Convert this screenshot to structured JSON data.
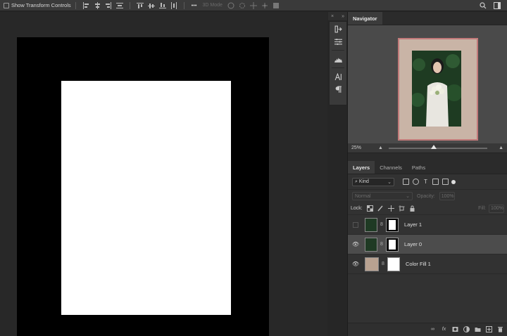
{
  "options_bar": {
    "show_transform_label": "Show Transform Controls",
    "mode_3d_label": "3D Mode",
    "more_label": "•••"
  },
  "navigator": {
    "tab_label": "Navigator",
    "zoom_value": "25%"
  },
  "layers_panel": {
    "tabs": [
      "Layers",
      "Channels",
      "Paths"
    ],
    "kind_label": "Kind",
    "blend_mode": "Normal",
    "opacity_label": "Opacity:",
    "opacity_value": "100%",
    "lock_label": "Lock:",
    "fill_label": "Fill:",
    "fill_value": "100%",
    "layers": [
      {
        "name": "Layer 1",
        "visible": false,
        "selected": false
      },
      {
        "name": "Layer 0",
        "visible": true,
        "selected": true
      },
      {
        "name": "Color Fill 1",
        "visible": true,
        "selected": false
      }
    ]
  },
  "colors": {
    "canvas_border": "#000000",
    "canvas_fill": "#ffffff",
    "color_fill": "#b9a291",
    "navigator_frame": "#c27a7a"
  },
  "icons": {
    "search": "search-icon",
    "workspace": "workspace-icon",
    "eye": "eye-icon",
    "link": "link-icon",
    "fx": "fx-icon"
  }
}
